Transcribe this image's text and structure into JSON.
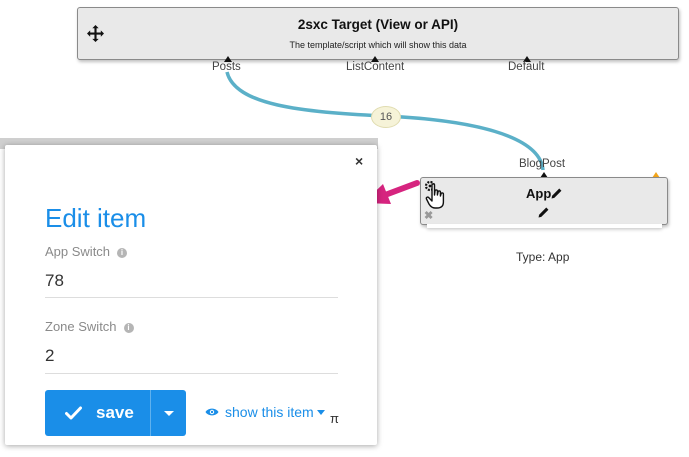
{
  "target_node": {
    "title": "2sxc Target (View or API)",
    "subtitle": "The template/script which will show this data",
    "ports": [
      "Posts",
      "ListContent",
      "Default"
    ]
  },
  "connection": {
    "count": "16"
  },
  "app_node": {
    "port": "BlogPost",
    "title": "App",
    "type_label": "Type: App"
  },
  "dialog": {
    "title": "Edit item",
    "fields": [
      {
        "label": "App Switch",
        "value": "78"
      },
      {
        "label": "Zone Switch",
        "value": "2"
      }
    ],
    "save_label": "save",
    "show_item_label": "show this item",
    "close_glyph": "×",
    "extra_glyph": "π"
  },
  "colors": {
    "accent": "#1a8ee8",
    "connector": "#5bb0c8",
    "arrow": "#d6247f",
    "warning": "#f2a51a"
  }
}
